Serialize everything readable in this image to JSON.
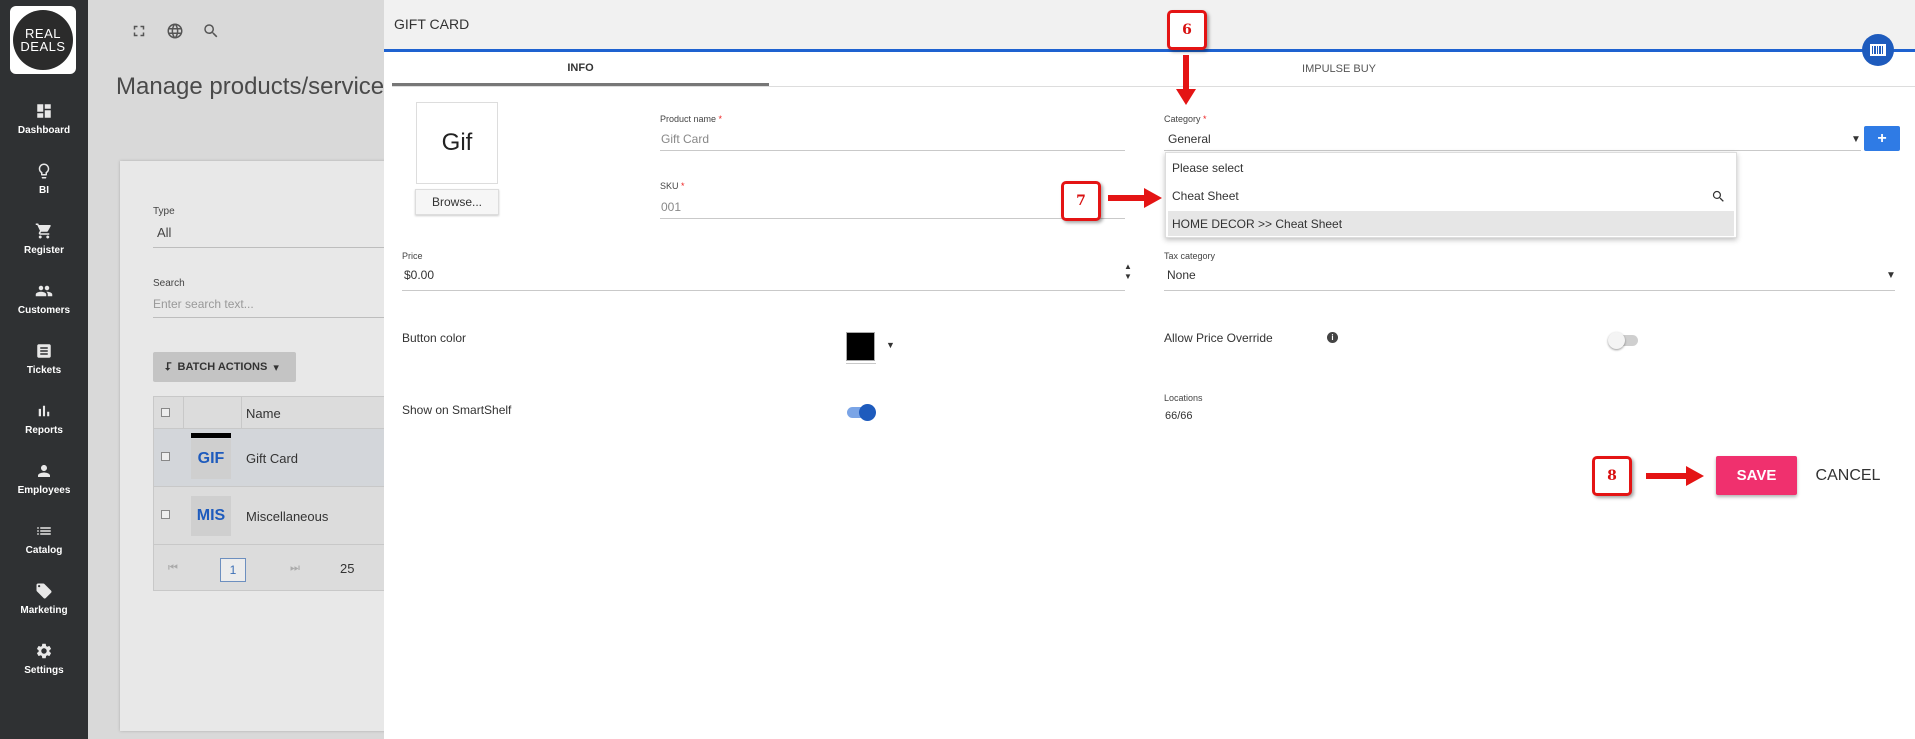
{
  "logo": {
    "line1": "REAL",
    "line2": "DEALS"
  },
  "sidebar": {
    "items": [
      {
        "label": "Dashboard",
        "icon": "dashboard-icon"
      },
      {
        "label": "BI",
        "icon": "lightbulb-icon"
      },
      {
        "label": "Register",
        "icon": "cart-icon"
      },
      {
        "label": "Customers",
        "icon": "customers-icon"
      },
      {
        "label": "Tickets",
        "icon": "tickets-icon"
      },
      {
        "label": "Reports",
        "icon": "reports-icon"
      },
      {
        "label": "Employees",
        "icon": "employee-icon"
      },
      {
        "label": "Catalog",
        "icon": "catalog-icon"
      },
      {
        "label": "Marketing",
        "icon": "tag-icon"
      },
      {
        "label": "Settings",
        "icon": "gear-icon"
      }
    ]
  },
  "background": {
    "page_title": "Manage products/services",
    "type_label": "Type",
    "type_value": "All",
    "search_label": "Search",
    "search_placeholder": "Enter search text...",
    "batch_actions": "BATCH ACTIONS",
    "table": {
      "name_header": "Name",
      "rows": [
        {
          "thumb": "GIF",
          "name": "Gift Card"
        },
        {
          "thumb": "MIS",
          "name": "Miscellaneous"
        }
      ],
      "page": "1",
      "page_size": "25"
    }
  },
  "modal": {
    "title": "GIFT CARD",
    "tabs": [
      "INFO",
      "IMPULSE BUY"
    ],
    "image_text": "Gif",
    "browse_label": "Browse...",
    "product_name": {
      "label": "Product name",
      "value": "Gift Card"
    },
    "sku": {
      "label": "SKU",
      "value": "001"
    },
    "category": {
      "label": "Category",
      "value": "General"
    },
    "dropdown": {
      "options": [
        "Please select"
      ],
      "search_value": "Cheat Sheet",
      "results": [
        "HOME DECOR >> Cheat Sheet"
      ]
    },
    "price": {
      "label": "Price",
      "value": "$0.00"
    },
    "tax_category": {
      "label": "Tax category",
      "value": "None"
    },
    "button_color": {
      "label": "Button color",
      "value": "#000000"
    },
    "allow_price_override": {
      "label": "Allow Price Override",
      "on": false
    },
    "smartshelf": {
      "label": "Show on SmartShelf",
      "on": true
    },
    "locations": {
      "label": "Locations",
      "value": "66/66"
    },
    "save_label": "SAVE",
    "cancel_label": "CANCEL"
  },
  "annotations": [
    "6",
    "7",
    "8"
  ],
  "colors": {
    "accent": "#1e62d0",
    "save": "#f0306e",
    "marker": "#e41414",
    "sidebar": "#2f3133"
  }
}
